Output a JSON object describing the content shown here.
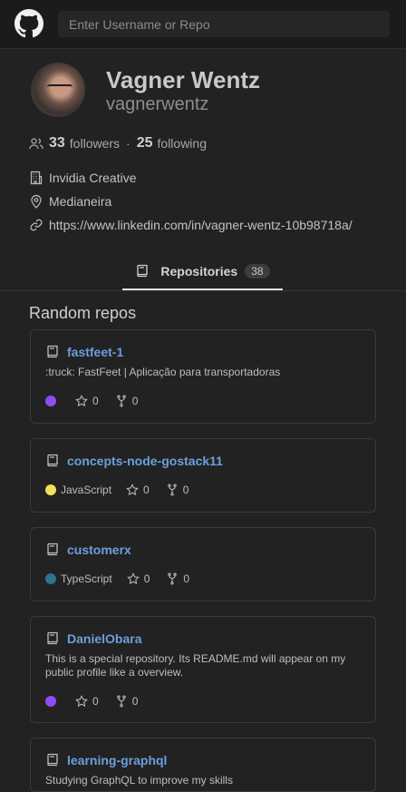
{
  "search": {
    "placeholder": "Enter Username or Repo"
  },
  "profile": {
    "name": "Vagner Wentz",
    "login": "vagnerwentz",
    "followers_count": "33",
    "followers_label": "followers",
    "separator": "·",
    "following_count": "25",
    "following_label": "following",
    "company": "Invidia Creative",
    "location": "Medianeira",
    "blog": "https://www.linkedin.com/in/vagner-wentz-10b98718a/"
  },
  "tabs": [
    {
      "label": "Repositories",
      "count": "38"
    }
  ],
  "section": {
    "title": "Random repos"
  },
  "repos": [
    {
      "name": "fastfeet-1",
      "description": ":truck: FastFeet | Aplicação para transportadoras",
      "language": "",
      "lang_color": "#8d4df3",
      "stars": "0",
      "forks": "0"
    },
    {
      "name": "concepts-node-gostack11",
      "description": "",
      "language": "JavaScript",
      "lang_color": "#f1e05a",
      "stars": "0",
      "forks": "0"
    },
    {
      "name": "customerx",
      "description": "",
      "language": "TypeScript",
      "lang_color": "#2b7489",
      "stars": "0",
      "forks": "0"
    },
    {
      "name": "DanielObara",
      "description": "This is a special repository. Its README.md will appear on my public profile like a overview.",
      "language": "",
      "lang_color": "#8d4df3",
      "stars": "0",
      "forks": "0"
    },
    {
      "name": "learning-graphql",
      "description": "Studying GraphQL to improve my skills",
      "language": "",
      "lang_color": "#8d4df3",
      "stars": "0",
      "forks": "0"
    }
  ],
  "icons": {
    "logo": "github-logo-icon",
    "followers": "people-icon",
    "company": "organization-icon",
    "location": "location-pin-icon",
    "blog": "link-icon",
    "repo": "repo-book-icon",
    "star": "star-icon",
    "fork": "fork-icon"
  }
}
